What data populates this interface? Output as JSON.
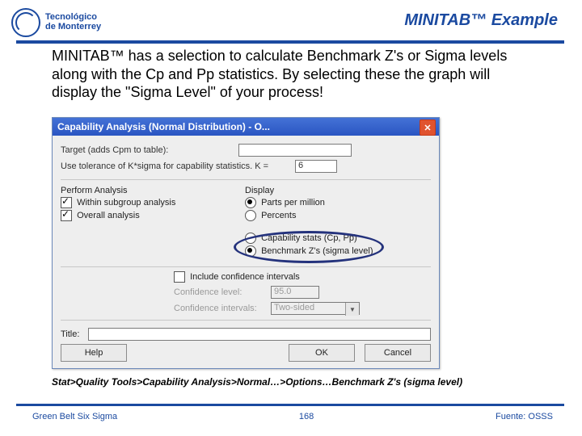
{
  "header": {
    "title": "MINITAB™ Example",
    "logo_line1": "Tecnológico",
    "logo_line2": "de Monterrey"
  },
  "body_text": "MINITAB™ has a selection to calculate Benchmark Z's or Sigma levels along with the Cp and Pp statistics. By selecting these the graph will display the \"Sigma Level\" of your process!",
  "dialog": {
    "title": "Capability Analysis (Normal Distribution) - O...",
    "target_label": "Target (adds Cpm to table):",
    "target_value": "",
    "tolerance_label": "Use tolerance of K*sigma for capability statistics.   K =",
    "tolerance_value": "6",
    "perform_heading": "Perform Analysis",
    "perform_opts": [
      {
        "label": "Within subgroup analysis",
        "checked": true
      },
      {
        "label": "Overall analysis",
        "checked": true
      }
    ],
    "display_heading": "Display",
    "display_opts": [
      {
        "label": "Parts per million",
        "selected": true
      },
      {
        "label": "Percents",
        "selected": false
      }
    ],
    "metric_opts": [
      {
        "label": "Capability stats (Cp, Pp)",
        "selected": false
      },
      {
        "label": "Benchmark Z's (sigma level)",
        "selected": true
      }
    ],
    "include_ci": {
      "label": "Include confidence intervals",
      "checked": false
    },
    "conf_level_label": "Confidence level:",
    "conf_level_value": "95.0",
    "conf_int_label": "Confidence intervals:",
    "conf_int_value": "Two-sided",
    "title_field_label": "Title:",
    "title_field_value": "",
    "buttons": {
      "help": "Help",
      "ok": "OK",
      "cancel": "Cancel"
    }
  },
  "nav_path": "Stat>Quality Tools>Capability Analysis>Normal…>Options…Benchmark Z's (sigma level)",
  "footer": {
    "left": "Green Belt Six Sigma",
    "page": "168",
    "right": "Fuente: OSSS"
  }
}
